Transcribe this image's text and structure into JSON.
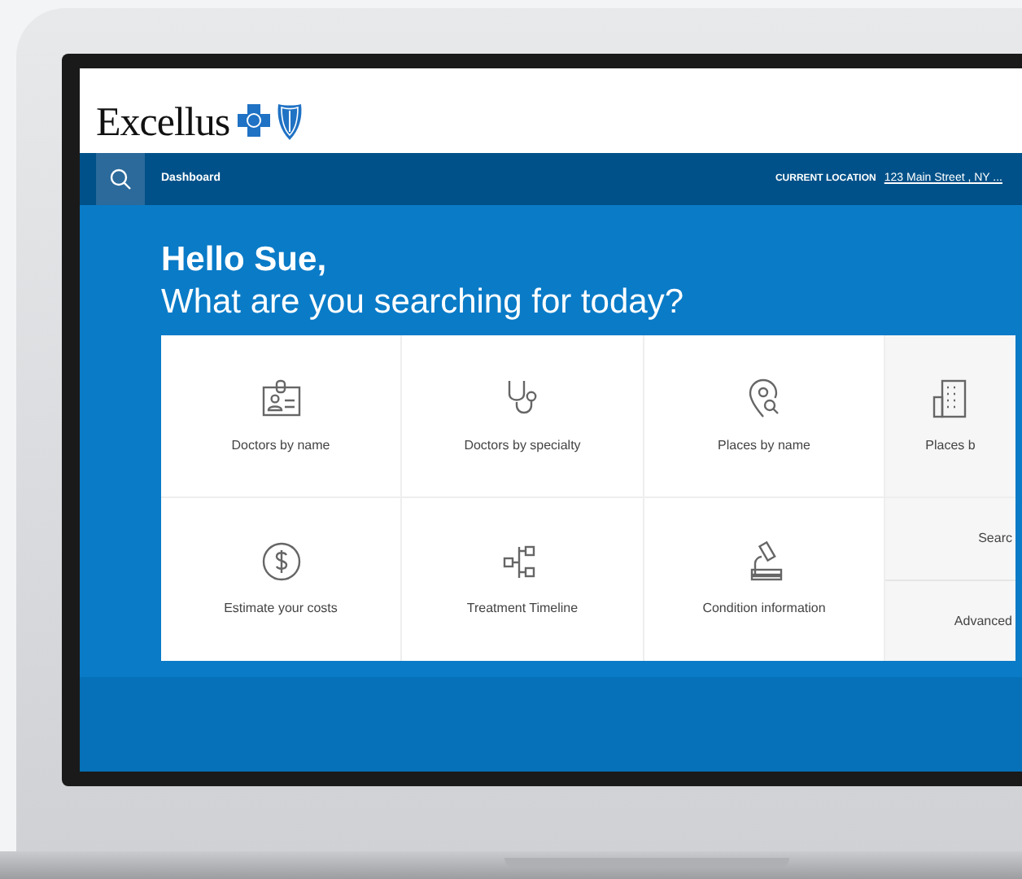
{
  "header": {
    "brand": "Excellus"
  },
  "navbar": {
    "page": "Dashboard",
    "location_label": "CURRENT LOCATION",
    "location": "123 Main Street , NY ..."
  },
  "hero": {
    "greeting": "Hello Sue,",
    "question": "What are you searching for today?"
  },
  "tiles": [
    {
      "label": "Doctors by name"
    },
    {
      "label": "Doctors by specialty"
    },
    {
      "label": "Places by name"
    },
    {
      "label": "Places b"
    },
    {
      "label": "Estimate your costs"
    },
    {
      "label": "Treatment Timeline"
    },
    {
      "label": "Condition information"
    }
  ],
  "side_links": [
    "Searc",
    "Advanced"
  ]
}
